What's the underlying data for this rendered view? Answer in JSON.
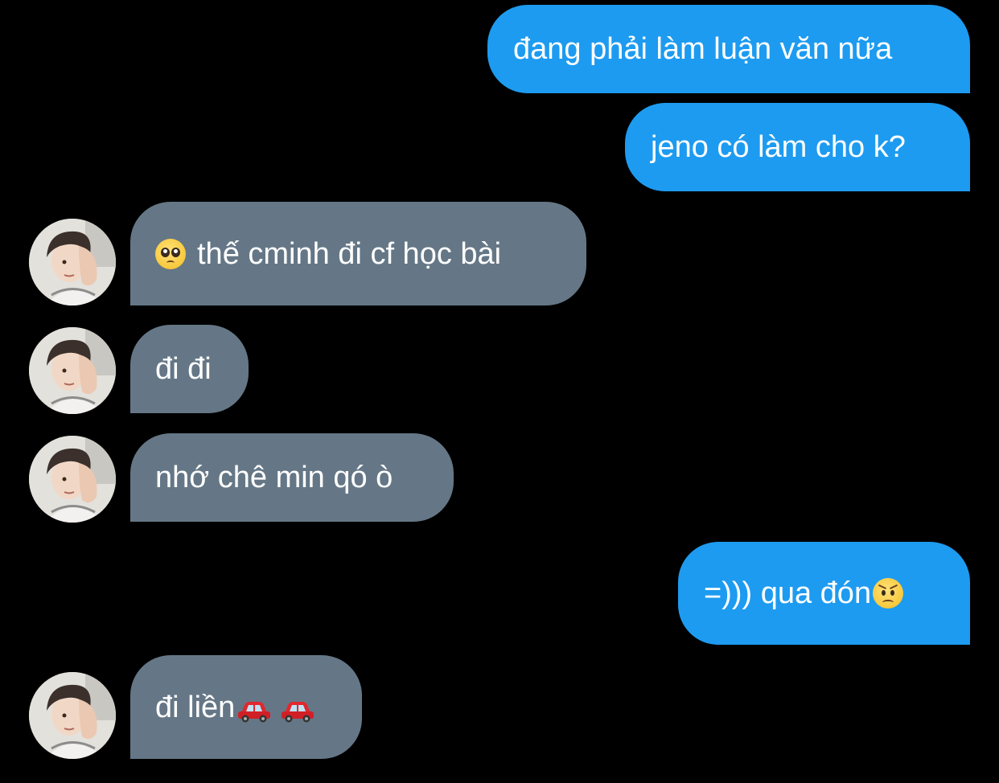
{
  "messages": [
    {
      "side": "out",
      "text": "đang phải làm luận văn nữa"
    },
    {
      "side": "out",
      "text": "jeno có làm cho k?"
    },
    {
      "side": "in",
      "emoji_before": "pleading-face",
      "text": "thế cminh đi cf học bài"
    },
    {
      "side": "in",
      "text": "đi đi"
    },
    {
      "side": "in",
      "text": "nhớ chê min qó ò"
    },
    {
      "side": "out",
      "text": "=))) qua đón",
      "emoji_after": "angry-face"
    },
    {
      "side": "in",
      "text": "đi liền",
      "emoji_after": [
        "red-car",
        "red-car"
      ]
    }
  ],
  "colors": {
    "background": "#000000",
    "outgoing_bubble": "#1d9bf0",
    "incoming_bubble": "#657786",
    "text": "#ffffff"
  }
}
